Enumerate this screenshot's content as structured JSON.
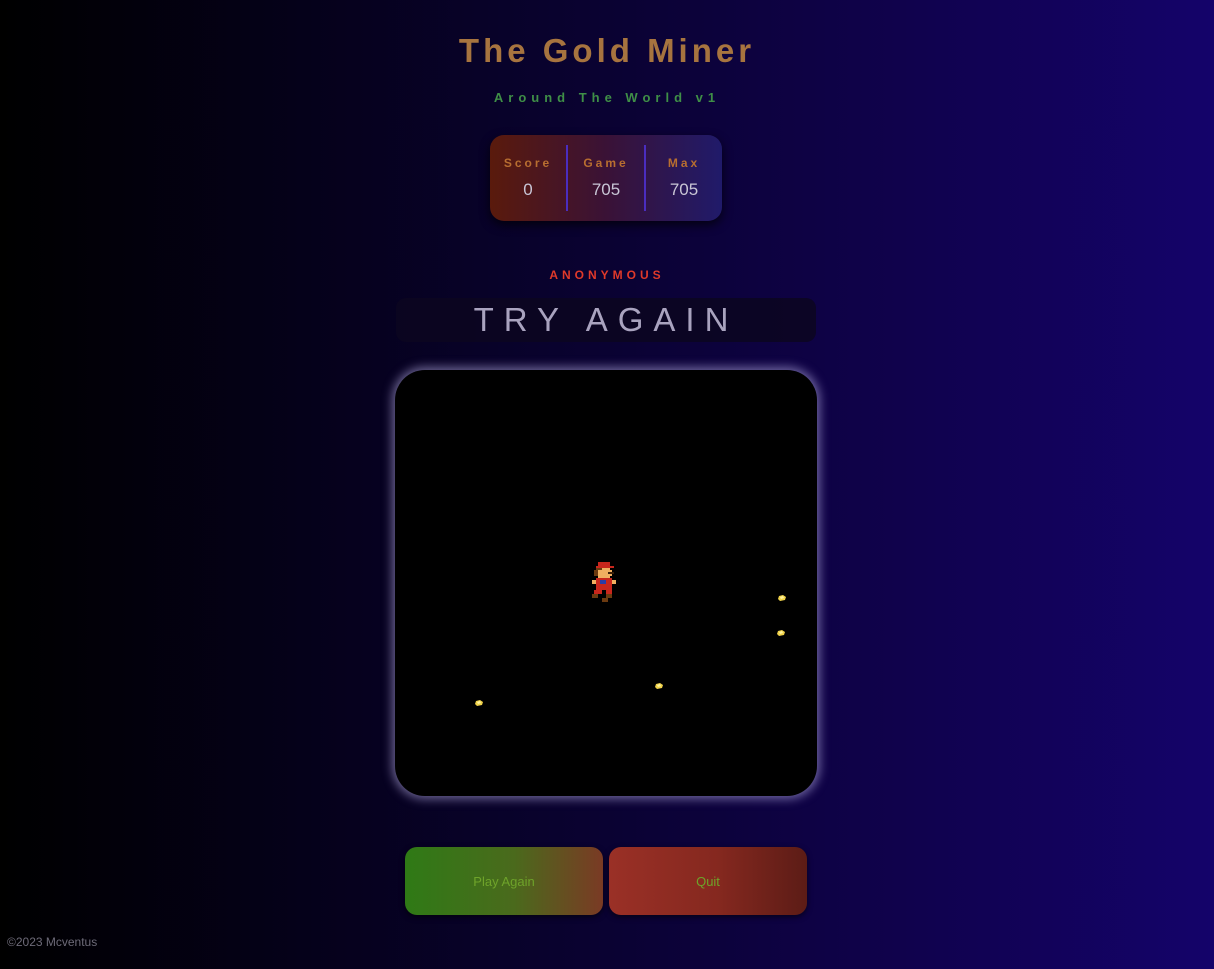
{
  "header": {
    "title": "The Gold Miner",
    "subtitle": "Around The World v1"
  },
  "scoreboard": {
    "score_label": "Score",
    "score_value": "0",
    "game_label": "Game",
    "game_value": "705",
    "max_label": "Max",
    "max_value": "705"
  },
  "player": {
    "name": "ANONYMOUS"
  },
  "status": {
    "message": "TRY AGAIN"
  },
  "board": {
    "sprites": {
      "miner": "mario-miner-sprite",
      "gold": "gold-nugget-sprite"
    }
  },
  "actions": {
    "play_again_label": "Play Again",
    "quit_label": "Quit"
  },
  "footer": {
    "copyright": "©2023 Mcventus"
  },
  "colors": {
    "title": "#a7743f",
    "subtitle": "#3f8f47",
    "player_name": "#e0392a",
    "button_text": "#6ea32a"
  }
}
